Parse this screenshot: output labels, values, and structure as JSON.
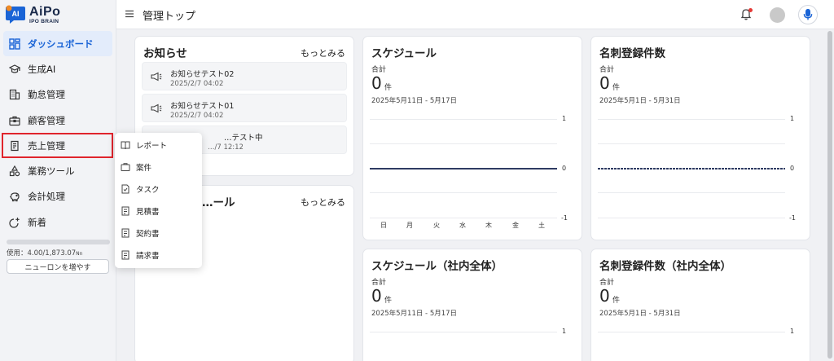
{
  "app": {
    "logo_text": "AiPo",
    "logo_sub": "IPO BRAIN",
    "logo_badge": "AI"
  },
  "header": {
    "page_title": "管理トップ"
  },
  "sidebar": {
    "items": [
      {
        "label": "ダッシュボード",
        "icon": "dashboard-icon"
      },
      {
        "label": "生成AI",
        "icon": "graduation-cap-icon"
      },
      {
        "label": "勤怠管理",
        "icon": "building-icon"
      },
      {
        "label": "顧客管理",
        "icon": "briefcase-icon"
      },
      {
        "label": "売上管理",
        "icon": "receipt-icon"
      },
      {
        "label": "業務ツール",
        "icon": "shapes-icon"
      },
      {
        "label": "会計処理",
        "icon": "piggy-bank-icon"
      },
      {
        "label": "新着",
        "icon": "new-icon"
      }
    ],
    "usage_text": "使用：4.00/1,873.07",
    "usage_unit": "Nn",
    "usage_fraction": 0.002,
    "neuron_button": "ニューロンを増やす"
  },
  "submenu": {
    "items": [
      {
        "label": "レポート",
        "icon": "report-icon"
      },
      {
        "label": "案件",
        "icon": "folder-icon"
      },
      {
        "label": "タスク",
        "icon": "task-icon"
      },
      {
        "label": "見積書",
        "icon": "document-icon"
      },
      {
        "label": "契約書",
        "icon": "document-icon"
      },
      {
        "label": "請求書",
        "icon": "document-icon"
      }
    ]
  },
  "news": {
    "title": "お知らせ",
    "more": "もっとみる",
    "items": [
      {
        "title": "お知らせテスト02",
        "date": "2025/2/7 04:02"
      },
      {
        "title": "お知らせテスト01",
        "date": "2025/2/7 04:02"
      },
      {
        "title": "…テスト中",
        "date": "…/7 12:12"
      }
    ]
  },
  "schedule_card": {
    "title_partial": "…ール",
    "more": "もっとみる"
  },
  "cards": {
    "schedule": {
      "title": "スケジュール",
      "total_label": "合計",
      "value": "0",
      "unit": "件",
      "range": "2025年5月11日 - 5月17日",
      "ticks": [
        "1",
        "0",
        "-1"
      ],
      "days": [
        "日",
        "月",
        "火",
        "水",
        "木",
        "金",
        "土"
      ]
    },
    "business_cards": {
      "title": "名刺登録件数",
      "total_label": "合計",
      "value": "0",
      "unit": "件",
      "range": "2025年5月1日 - 5月31日",
      "ticks": [
        "1",
        "0",
        "-1"
      ]
    },
    "schedule_all": {
      "title": "スケジュール（社内全体）",
      "total_label": "合計",
      "value": "0",
      "unit": "件",
      "range": "2025年5月11日 - 5月17日",
      "ticks": [
        "1"
      ]
    },
    "business_cards_all": {
      "title": "名刺登録件数（社内全体）",
      "total_label": "合計",
      "value": "0",
      "unit": "件",
      "range": "2025年5月1日 - 5月31日",
      "ticks": [
        "1"
      ]
    }
  },
  "colors": {
    "accent": "#1a64d6",
    "highlight_border": "#e0242c",
    "zero_line": "#2f3b63"
  }
}
